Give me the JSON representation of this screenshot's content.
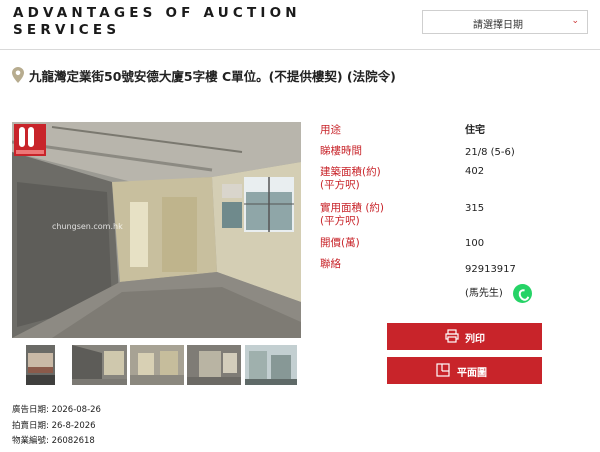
{
  "header": {
    "brand_line1": "ADVANTAGES OF AUCTION",
    "brand_line2": "SERVICES",
    "date_select": {
      "label": "請選擇日期",
      "icon": "chevron-down-icon"
    }
  },
  "property": {
    "title": "九龍灣定業街50號安德大廈5字樓 C單位。(不提供樓契) (法院令)",
    "watermark": "chungsen.com.hk"
  },
  "details": [
    {
      "label": "用途",
      "value": "住宅"
    },
    {
      "label": "睇樓時間",
      "value": "21/8 (5-6)"
    },
    {
      "label": "建築面積(約)\n(平方呎)",
      "value": "402"
    },
    {
      "label": "實用面積 (約)\n(平方呎)",
      "value": "315"
    },
    {
      "label": "開價(萬)",
      "value": "100"
    },
    {
      "label": "聯絡",
      "value": "92913917"
    }
  ],
  "contact": {
    "name": "(馬先生)",
    "icon": "whatsapp-icon"
  },
  "buttons": {
    "print": "列印",
    "floorplan": "平面圖"
  },
  "meta": {
    "ad_date": "廣告日期: 2026-08-26",
    "auction_date": "拍賣日期: 26-8-2026",
    "property_no": "物業編號: 26082618"
  },
  "colors": {
    "accent": "#c8242a",
    "whatsapp": "#25d366"
  }
}
